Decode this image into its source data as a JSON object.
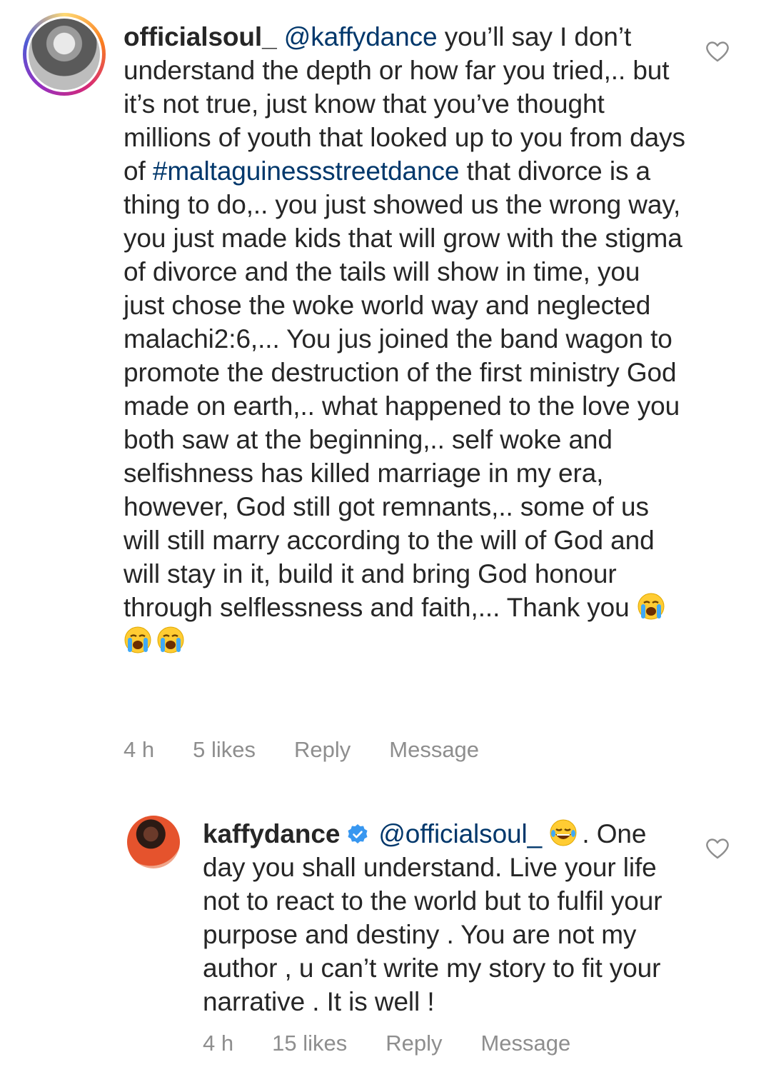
{
  "comments": [
    {
      "username": "officialsoul_",
      "mention": "@kaffydance",
      "text_before_hashtag": " you’ll say I don’t understand the depth or how far you tried,.. but it’s not true, just know that you’ve thought millions of youth that looked up to you from days of ",
      "hashtag": "#maltaguinessstreetdance",
      "text_after_hashtag": " that divorce is a thing to do,.. you just showed us the wrong way, you just made kids that will grow with the stigma of divorce and the tails will show in time, you just chose the woke world way and neglected malachi2:6,... You jus joined the band wagon to promote the destruction of the first ministry God made on earth,.. what happened to the love you both saw at the beginning,.. self woke and selfishness has killed marriage in my era, however, God still got remnants,.. some of us will still marry according to the will of God and will stay in it, build it and bring God honour through selflessness and faith,... Thank you ",
      "emojis": [
        "loudly-crying-face",
        "loudly-crying-face",
        "loudly-crying-face"
      ],
      "time": "4 h",
      "likes": "5 likes",
      "reply_label": "Reply",
      "message_label": "Message"
    },
    {
      "username": "kaffydance",
      "verified": true,
      "mention": "@officialsoul_",
      "emoji": "tears-of-joy-face",
      "text": ". One day you shall understand. Live your life not to react to the world but to fulfil your purpose and destiny . You are not my author , u can’t write my story to fit your narrative . It is well !",
      "time": "4 h",
      "likes": "15 likes",
      "reply_label": "Reply",
      "message_label": "Message"
    }
  ],
  "colors": {
    "text": "#262626",
    "link": "#00376b",
    "meta": "#8e8e8e",
    "verified": "#3897f0"
  }
}
